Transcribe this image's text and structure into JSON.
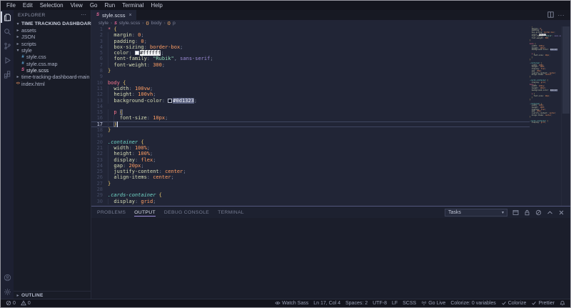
{
  "menu_bar": {
    "items": [
      "File",
      "Edit",
      "Selection",
      "View",
      "Go",
      "Run",
      "Terminal",
      "Help"
    ]
  },
  "activity_bar": {
    "top": [
      "explorer",
      "search",
      "source-control",
      "run-debug",
      "extensions"
    ],
    "bottom": [
      "account",
      "settings"
    ]
  },
  "sidebar": {
    "title": "EXPLORER",
    "more_label": "···",
    "root_label": "TIME TRACKING DASHBOARD",
    "items": [
      {
        "label": "assets",
        "type": "folder",
        "depth": 1,
        "expanded": false
      },
      {
        "label": "JSON",
        "type": "folder",
        "depth": 1,
        "expanded": false
      },
      {
        "label": "scripts",
        "type": "folder",
        "depth": 1,
        "expanded": false
      },
      {
        "label": "style",
        "type": "folder",
        "depth": 1,
        "expanded": true
      },
      {
        "label": "style.css",
        "type": "css",
        "depth": 2
      },
      {
        "label": "style.css.map",
        "type": "css",
        "depth": 2
      },
      {
        "label": "style.scss",
        "type": "sass",
        "depth": 2,
        "selected": true
      },
      {
        "label": "time-tracking-dashboard-main",
        "type": "folder",
        "depth": 1,
        "expanded": false
      },
      {
        "label": "index.html",
        "type": "html",
        "depth": 1
      }
    ],
    "outline_label": "OUTLINE"
  },
  "editor": {
    "tab": {
      "label": "style.scss",
      "close_label": "×"
    },
    "actions_more_label": "···",
    "breadcrumbs": [
      {
        "label": "style",
        "icon": ""
      },
      {
        "label": "style.scss",
        "icon": "sass"
      },
      {
        "label": "body",
        "icon": "sym"
      },
      {
        "label": "p",
        "icon": "sym"
      }
    ],
    "current_line": 17,
    "code_lines": [
      [
        [
          "sel",
          "*"
        ],
        [
          "pun",
          " "
        ],
        [
          "brace",
          "{"
        ]
      ],
      [
        [
          "ind",
          "  "
        ],
        [
          "prop",
          "margin"
        ],
        [
          "pun",
          ": "
        ],
        [
          "val",
          "0"
        ],
        [
          "pun",
          ";"
        ]
      ],
      [
        [
          "ind",
          "  "
        ],
        [
          "prop",
          "padding"
        ],
        [
          "pun",
          ": "
        ],
        [
          "val",
          "0"
        ],
        [
          "pun",
          ";"
        ]
      ],
      [
        [
          "ind",
          "  "
        ],
        [
          "prop",
          "box-sizing"
        ],
        [
          "pun",
          ": "
        ],
        [
          "val",
          "border-box"
        ],
        [
          "pun",
          ";"
        ]
      ],
      [
        [
          "ind",
          "  "
        ],
        [
          "prop",
          "color"
        ],
        [
          "pun",
          ": "
        ],
        [
          "swW",
          ""
        ],
        [
          "hlW",
          "#ffffff"
        ],
        [
          "pun",
          ";"
        ]
      ],
      [
        [
          "ind",
          "  "
        ],
        [
          "prop",
          "font-family"
        ],
        [
          "pun",
          ": "
        ],
        [
          "str",
          "\"Rubik\""
        ],
        [
          "pun",
          ", "
        ],
        [
          "pur",
          "sans-serif"
        ],
        [
          "pun",
          ";"
        ]
      ],
      [
        [
          "ind",
          "  "
        ],
        [
          "prop",
          "font-weight"
        ],
        [
          "pun",
          ": "
        ],
        [
          "val",
          "300"
        ],
        [
          "pun",
          ";"
        ]
      ],
      [
        [
          "brace",
          "}"
        ]
      ],
      [],
      [
        [
          "sel",
          "body"
        ],
        [
          "pun",
          " "
        ],
        [
          "brace",
          "{"
        ]
      ],
      [
        [
          "ind",
          "  "
        ],
        [
          "prop",
          "width"
        ],
        [
          "pun",
          ": "
        ],
        [
          "val",
          "100vw"
        ],
        [
          "pun",
          ";"
        ]
      ],
      [
        [
          "ind",
          "  "
        ],
        [
          "prop",
          "height"
        ],
        [
          "pun",
          ": "
        ],
        [
          "val",
          "100vh"
        ],
        [
          "pun",
          ";"
        ]
      ],
      [
        [
          "ind",
          "  "
        ],
        [
          "prop",
          "background-color"
        ],
        [
          "pun",
          ": "
        ],
        [
          "swD",
          ""
        ],
        [
          "hlD",
          "#0d1323"
        ],
        [
          "pun",
          ";"
        ]
      ],
      [],
      [
        [
          "ind",
          "  "
        ],
        [
          "sel",
          "p"
        ],
        [
          "pun",
          " "
        ],
        [
          "box",
          "{"
        ]
      ],
      [
        [
          "ind",
          "  "
        ],
        [
          "ind",
          "  "
        ],
        [
          "prop",
          "font-size"
        ],
        [
          "pun",
          ": "
        ],
        [
          "val",
          "10px"
        ],
        [
          "pun",
          ";"
        ]
      ],
      [
        [
          "ind",
          "  "
        ],
        [
          "box",
          "}"
        ],
        [
          "cur",
          ""
        ]
      ],
      [
        [
          "brace",
          "}"
        ]
      ],
      [],
      [
        [
          "cls",
          ".container"
        ],
        [
          "pun",
          " "
        ],
        [
          "brace",
          "{"
        ]
      ],
      [
        [
          "ind",
          "  "
        ],
        [
          "prop",
          "width"
        ],
        [
          "pun",
          ": "
        ],
        [
          "val",
          "100%"
        ],
        [
          "pun",
          ";"
        ]
      ],
      [
        [
          "ind",
          "  "
        ],
        [
          "prop",
          "height"
        ],
        [
          "pun",
          ": "
        ],
        [
          "val",
          "100%"
        ],
        [
          "pun",
          ";"
        ]
      ],
      [
        [
          "ind",
          "  "
        ],
        [
          "prop",
          "display"
        ],
        [
          "pun",
          ": "
        ],
        [
          "val",
          "flex"
        ],
        [
          "pun",
          ";"
        ]
      ],
      [
        [
          "ind",
          "  "
        ],
        [
          "prop",
          "gap"
        ],
        [
          "pun",
          ": "
        ],
        [
          "val",
          "20px"
        ],
        [
          "pun",
          ";"
        ]
      ],
      [
        [
          "ind",
          "  "
        ],
        [
          "prop",
          "justify-content"
        ],
        [
          "pun",
          ": "
        ],
        [
          "val",
          "center"
        ],
        [
          "pun",
          ";"
        ]
      ],
      [
        [
          "ind",
          "  "
        ],
        [
          "prop",
          "align-items"
        ],
        [
          "pun",
          ": "
        ],
        [
          "val",
          "center"
        ],
        [
          "pun",
          ";"
        ]
      ],
      [
        [
          "brace",
          "}"
        ]
      ],
      [],
      [
        [
          "cls",
          ".cards-container"
        ],
        [
          "pun",
          " "
        ],
        [
          "brace",
          "{"
        ]
      ],
      [
        [
          "ind",
          "  "
        ],
        [
          "prop",
          "display"
        ],
        [
          "pun",
          ": "
        ],
        [
          "val",
          "grid"
        ],
        [
          "pun",
          ";"
        ]
      ]
    ]
  },
  "panel": {
    "tabs": [
      {
        "label": "PROBLEMS",
        "active": false
      },
      {
        "label": "OUTPUT",
        "active": true
      },
      {
        "label": "DEBUG CONSOLE",
        "active": false
      },
      {
        "label": "TERMINAL",
        "active": false
      }
    ],
    "dropdown_value": "Tasks",
    "action_icons": [
      "open-output-editor",
      "scroll-lock",
      "clear-output",
      "maximize-panel",
      "close-panel"
    ]
  },
  "status_bar": {
    "left": [
      {
        "icon": "error",
        "label": "0"
      },
      {
        "icon": "warning",
        "label": "0"
      }
    ],
    "right": [
      {
        "icon": "eye",
        "label": "Watch Sass"
      },
      {
        "icon": "",
        "label": "Ln 17, Col 4"
      },
      {
        "icon": "",
        "label": "Spaces: 2"
      },
      {
        "icon": "",
        "label": "UTF-8"
      },
      {
        "icon": "",
        "label": "LF"
      },
      {
        "icon": "",
        "label": "SCSS"
      },
      {
        "icon": "broadcast",
        "label": "Go Live"
      },
      {
        "icon": "",
        "label": "Colorize: 0 variables"
      },
      {
        "icon": "check",
        "label": "Colorize"
      },
      {
        "icon": "check",
        "label": "Prettier"
      },
      {
        "icon": "bell",
        "label": ""
      }
    ]
  },
  "colors": {
    "editor_bg": "#212536",
    "sidebar_bg": "#191c27",
    "statusbar_bg": "#13141d",
    "accent_underline": "#9d8cd8",
    "hex_value_white": "#ffffff",
    "hex_value_dark": "#0d1323"
  }
}
